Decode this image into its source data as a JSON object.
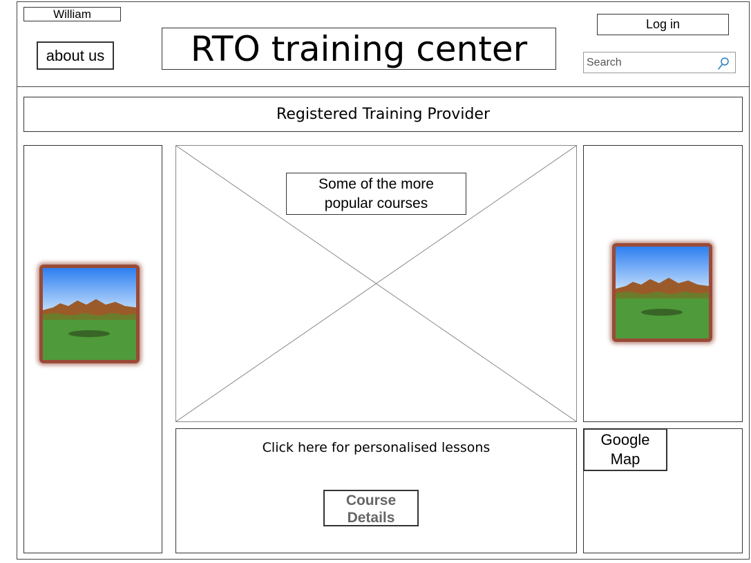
{
  "header": {
    "user_name": "William",
    "about_us_label": "about us",
    "site_title": "RTO training center",
    "login_label": "Log in",
    "search": {
      "placeholder": "Search"
    }
  },
  "banner": {
    "text": "Registered Training Provider"
  },
  "main": {
    "popular_courses_line1": "Some of the more",
    "popular_courses_line2": "popular courses",
    "lessons_link": "Click here for personalised lessons",
    "course_details_line1": "Course",
    "course_details_line2": "Details"
  },
  "sidebar_right": {
    "map_line1": "Google",
    "map_line2": "Map"
  },
  "icons": {
    "search": "search-icon",
    "image": "landscape-image-icon"
  },
  "colors": {
    "border": "#333333",
    "button_text_muted": "#666666",
    "search_icon": "#2a7fbf"
  }
}
